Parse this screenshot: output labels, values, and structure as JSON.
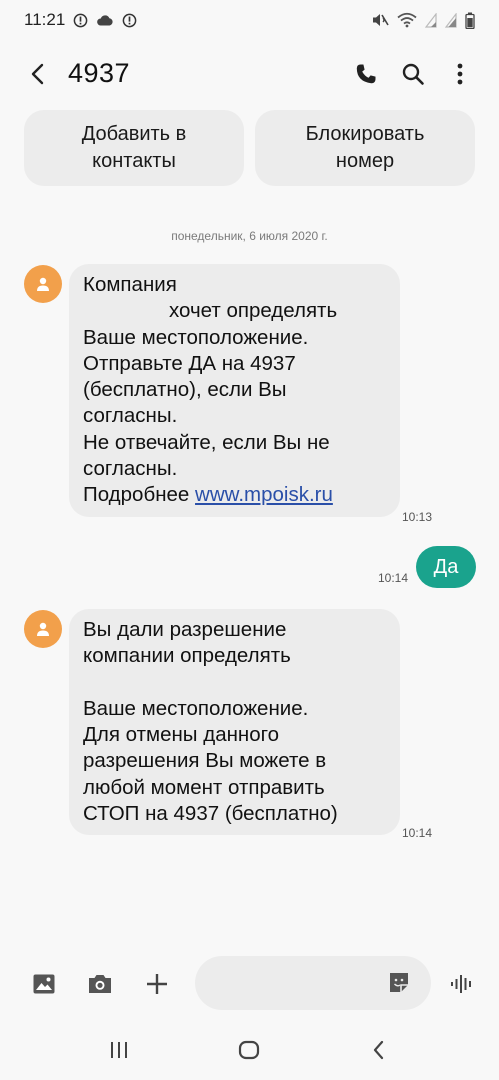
{
  "status_bar": {
    "time": "11:21",
    "icons_left": [
      "alert-icon",
      "cloud-icon",
      "alert-icon"
    ],
    "icons_right": [
      "mute-icon",
      "wifi-icon",
      "signal-icon",
      "signal-icon",
      "battery-icon"
    ]
  },
  "header": {
    "title": "4937",
    "icons": [
      "back-arrow-icon",
      "phone-icon",
      "search-icon",
      "more-vert-icon"
    ]
  },
  "actions": {
    "add_contact_line1": "Добавить в",
    "add_contact_line2": "контакты",
    "block_line1": "Блокировать",
    "block_line2": "номер"
  },
  "conversation": {
    "date": "понедельник, 6 июля 2020 г.",
    "messages": [
      {
        "direction": "incoming",
        "lines": [
          "Компания",
          "хочет определять",
          "Ваше местоположение.",
          "Отправьте ДА на 4937",
          "(бесплатно), если Вы",
          "согласны.",
          "Не отвечайте, если Вы не",
          "согласны."
        ],
        "more_label": "Подробнее",
        "link": "www.mpoisk.ru",
        "time": "10:13"
      },
      {
        "direction": "outgoing",
        "text": "Да",
        "time": "10:14"
      },
      {
        "direction": "incoming",
        "lines": [
          "Вы дали разрешение",
          "компании определять",
          "",
          "Ваше местоположение.",
          "Для отмены данного",
          "разрешения Вы можете в",
          "любой момент отправить",
          "СТОП на 4937 (бесплатно)"
        ],
        "time": "10:14"
      }
    ]
  },
  "composer": {
    "input_value": "",
    "icons": [
      "gallery-icon",
      "camera-icon",
      "plus-icon",
      "sticker-icon",
      "voice-icon"
    ]
  },
  "nav": {
    "icons": [
      "recents-icon",
      "home-icon",
      "back-icon"
    ]
  },
  "colors": {
    "background": "#f8f8f8",
    "bubble_in": "#ececec",
    "bubble_out": "#1aa38d",
    "avatar": "#f2a04b",
    "link": "#2a4fa8"
  }
}
